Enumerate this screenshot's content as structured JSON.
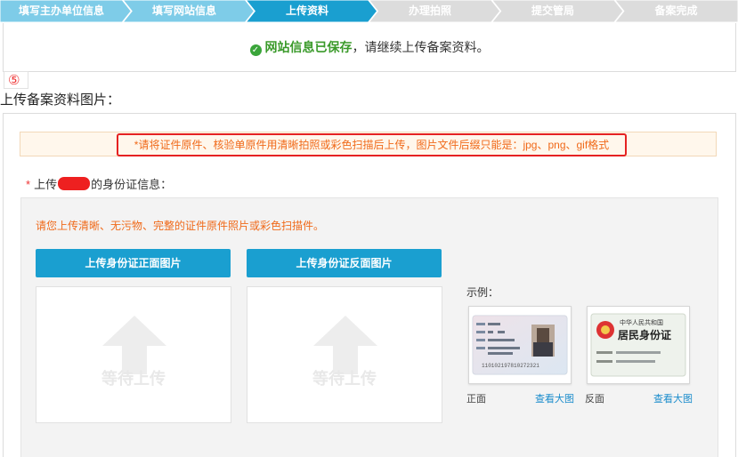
{
  "steps": [
    {
      "label": "填写主办单位信息",
      "state": "done"
    },
    {
      "label": "填写网站信息",
      "state": "done"
    },
    {
      "label": "上传资料",
      "state": "current"
    },
    {
      "label": "办理拍照",
      "state": "todo"
    },
    {
      "label": "提交管局",
      "state": "todo"
    },
    {
      "label": "备案完成",
      "state": "todo"
    }
  ],
  "saved": {
    "check_icon": "check-circle-icon",
    "highlight": "网站信息已保存",
    "rest": "，请继续上传备案资料。"
  },
  "circled_number": "⑤",
  "section_title": "上传备案资料图片：",
  "notice": "*请将证件原件、核验单原件用清晰拍照或彩色扫描后上传，图片文件后缀只能是：jpg、png、gif格式",
  "id_upload": {
    "required_mark": "*",
    "prefix": "上传",
    "suffix": "的身份证信息：",
    "hint": "请您上传清晰、无污物、完整的证件原件照片或彩色扫描件。",
    "front_button": "上传身份证正面图片",
    "back_button": "上传身份证反面图片",
    "front_placeholder": "等待上传",
    "back_placeholder": "等待上传"
  },
  "example": {
    "label": "示例：",
    "front_caption": "正面",
    "back_caption": "反面",
    "view_link": "查看大图",
    "front_sample": {
      "name": "张三",
      "sex": "男",
      "ethnicity": "汉",
      "id_number": "110102197810272321"
    },
    "back_sample": {
      "country": "中华人民共和国",
      "title": "居民身份证"
    }
  },
  "colors": {
    "step_done": "#7ecce8",
    "step_current": "#1a9fd0",
    "step_todo": "#dcdcdc",
    "accent": "#1a9fd0",
    "warning_text": "#f06a1a",
    "success": "#3a9a2a"
  }
}
